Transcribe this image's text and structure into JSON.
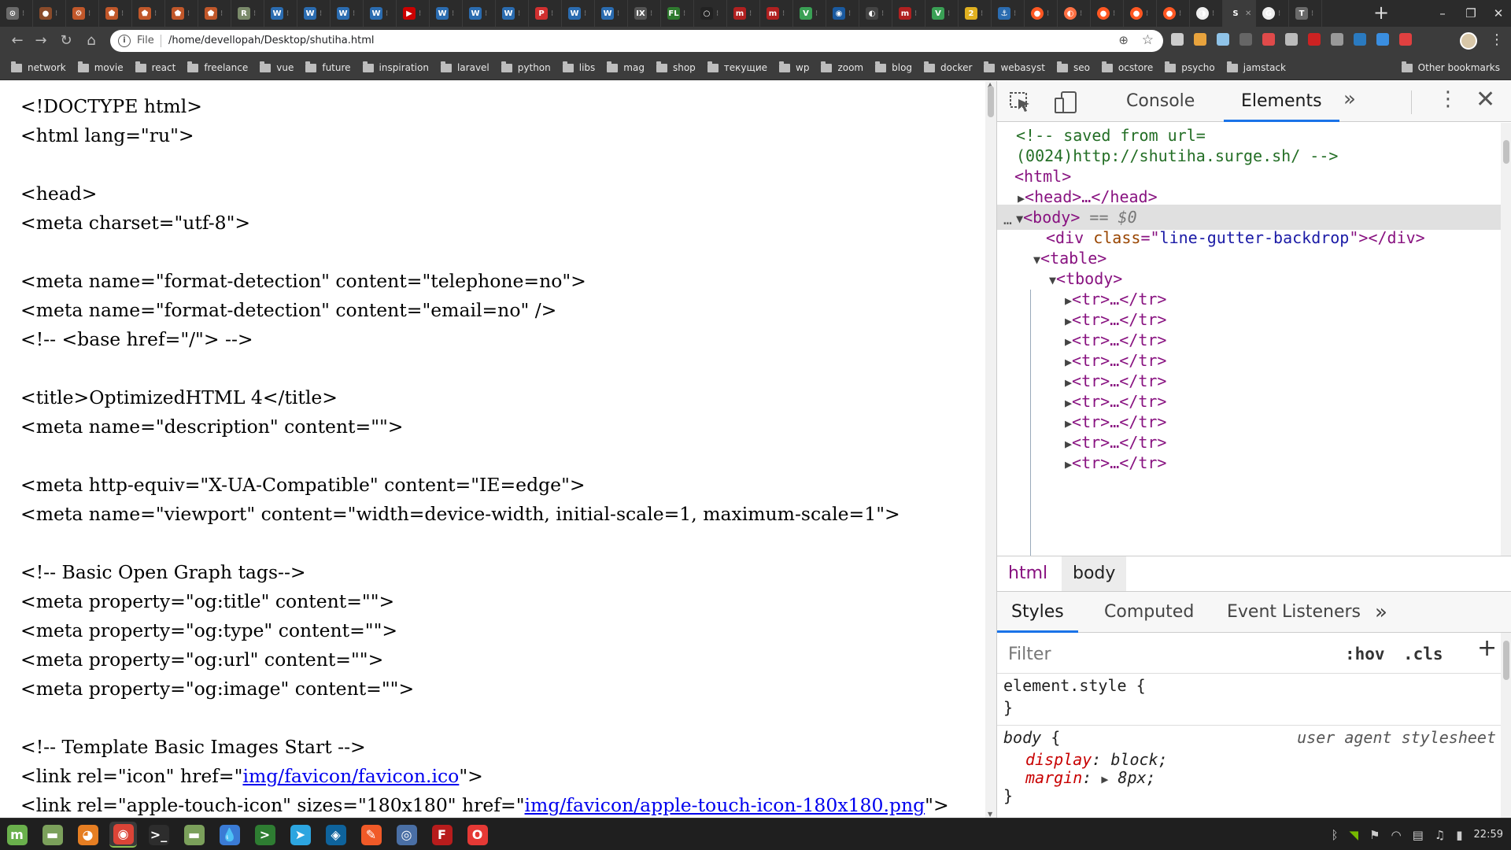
{
  "tabs": [
    {
      "fav": "#6a6a6a",
      "glyph": "⊙"
    },
    {
      "fav": "#8a4b2a",
      "glyph": "●"
    },
    {
      "fav": "#c0572a",
      "glyph": "⚙"
    },
    {
      "fav": "#c0572a",
      "glyph": "⬟"
    },
    {
      "fav": "#c0572a",
      "glyph": "⬟"
    },
    {
      "fav": "#c0572a",
      "glyph": "⬟"
    },
    {
      "fav": "#c0572a",
      "glyph": "⬟"
    },
    {
      "fav": "#7a8a6a",
      "glyph": "R"
    },
    {
      "fav": "#2b6cb0",
      "glyph": "W"
    },
    {
      "fav": "#2b6cb0",
      "glyph": "W"
    },
    {
      "fav": "#2b6cb0",
      "glyph": "W"
    },
    {
      "fav": "#2b6cb0",
      "glyph": "W"
    },
    {
      "fav": "#cc0000",
      "glyph": "▶"
    },
    {
      "fav": "#2b6cb0",
      "glyph": "W"
    },
    {
      "fav": "#2b6cb0",
      "glyph": "W"
    },
    {
      "fav": "#2b6cb0",
      "glyph": "W"
    },
    {
      "fav": "#d03030",
      "glyph": "P"
    },
    {
      "fav": "#2b6cb0",
      "glyph": "W"
    },
    {
      "fav": "#2b6cb0",
      "glyph": "W"
    },
    {
      "fav": "#555555",
      "glyph": "IX"
    },
    {
      "fav": "#2f7a2f",
      "glyph": "FL"
    },
    {
      "fav": "#222222",
      "glyph": "○"
    },
    {
      "fav": "#b02020",
      "glyph": "m"
    },
    {
      "fav": "#b02020",
      "glyph": "m"
    },
    {
      "fav": "#3aa055",
      "glyph": "V"
    },
    {
      "fav": "#1a5aa0",
      "glyph": "◉"
    },
    {
      "fav": "#444444",
      "glyph": "◐"
    },
    {
      "fav": "#b02020",
      "glyph": "m"
    },
    {
      "fav": "#3aa055",
      "glyph": "V"
    },
    {
      "fav": "#e0b020",
      "glyph": "2"
    },
    {
      "fav": "#2b6cb0",
      "glyph": "⚓"
    },
    {
      "fav": "#ff5722",
      "glyph": "●",
      "round": true
    },
    {
      "fav": "#ff7043",
      "glyph": "◐",
      "round": true
    },
    {
      "fav": "#ff5722",
      "glyph": "●",
      "round": true
    },
    {
      "fav": "#ff5722",
      "glyph": "●",
      "round": true
    },
    {
      "fav": "#ff5722",
      "glyph": "●",
      "round": true
    },
    {
      "fav": "#eeeeee",
      "glyph": "◑",
      "round": true
    },
    {
      "fav": "#3c3c3c",
      "glyph": "S",
      "active": true
    },
    {
      "fav": "#eeeeee",
      "glyph": "G",
      "round": true
    },
    {
      "fav": "#6a6a6a",
      "glyph": "T"
    }
  ],
  "toolbar": {
    "scheme": "File",
    "url": "/home/devellopah/Desktop/shutiha.html"
  },
  "extensions": [
    "#cccccc",
    "#e8a33d",
    "#8fc3e8",
    "#666666",
    "#e04a4a",
    "#bbbbbb",
    "#cc2222",
    "#999999",
    "#2a7ac0",
    "#3a8ee0",
    "#e04040"
  ],
  "bookmarks": [
    "network",
    "movie",
    "react",
    "freelance",
    "vue",
    "future",
    "inspiration",
    "laravel",
    "python",
    "libs",
    "mag",
    "shop",
    "текущие",
    "wp",
    "zoom",
    "blog",
    "docker",
    "webasyst",
    "seo",
    "ocstore",
    "psycho",
    "jamstack"
  ],
  "bookmarks_other": "Other bookmarks",
  "code_lines": [
    {
      "t": "<!DOCTYPE html>"
    },
    {
      "t": "<html lang=\"ru\">"
    },
    {
      "t": ""
    },
    {
      "t": "<head>"
    },
    {
      "t": "<meta charset=\"utf-8\">"
    },
    {
      "t": ""
    },
    {
      "t": "<meta name=\"format-detection\" content=\"telephone=no\">"
    },
    {
      "t": "<meta name=\"format-detection\" content=\"email=no\" />"
    },
    {
      "t": "<!-- <base href=\"/\"> -->"
    },
    {
      "t": ""
    },
    {
      "t": "<title>OptimizedHTML 4</title>"
    },
    {
      "t": "<meta name=\"description\" content=\"\">"
    },
    {
      "t": ""
    },
    {
      "t": "<meta http-equiv=\"X-UA-Compatible\" content=\"IE=edge\">"
    },
    {
      "t": "<meta name=\"viewport\" content=\"width=device-width, initial-scale=1, maximum-scale=1\">"
    },
    {
      "t": ""
    },
    {
      "t": "<!-- Basic Open Graph tags-->"
    },
    {
      "t": "<meta property=\"og:title\" content=\"\">"
    },
    {
      "t": "<meta property=\"og:type\" content=\"\">"
    },
    {
      "t": "<meta property=\"og:url\" content=\"\">"
    },
    {
      "t": "<meta property=\"og:image\" content=\"\">"
    },
    {
      "t": ""
    },
    {
      "t": "<!-- Template Basic Images Start -->"
    },
    {
      "t": "<link rel=\"icon\" href=\"",
      "link": "img/favicon/favicon.ico",
      "after": "\">"
    },
    {
      "t": "<link rel=\"apple-touch-icon\" sizes=\"180x180\" href=\"",
      "link": "img/favicon/apple-touch-icon-180x180.png",
      "after": "\">"
    }
  ],
  "devtools": {
    "tabs": [
      "Console",
      "Elements"
    ],
    "active_tab": "Elements",
    "tree": {
      "comment_1": "<!-- saved from url=",
      "comment_2": "(0024)http://shutiha.surge.sh/ -->",
      "html_open": "<html>",
      "head_collapsed": "<head>…</head>",
      "body_open": "<body>",
      "body_marker": "== $0",
      "div_tag": "div",
      "div_attr_name": "class",
      "div_attr_value": "line-gutter-backdrop",
      "table_open": "<table>",
      "tbody_open": "<tbody>",
      "tr_collapsed": "<tr>…</tr>",
      "tr_count": 9
    },
    "breadcrumbs": [
      "html",
      "body"
    ],
    "styles_tabs": [
      "Styles",
      "Computed",
      "Event Listeners"
    ],
    "filter_placeholder": "Filter",
    "hov_label": ":hov",
    "cls_label": ".cls",
    "rules": {
      "element_style_open": "element.style {",
      "close_brace": "}",
      "body_selector": "body",
      "open_brace": " {",
      "ua_label": "user agent stylesheet",
      "decl_1_prop": "display",
      "decl_1_val": "block;",
      "decl_2_prop": "margin",
      "decl_2_val": "8px;"
    }
  },
  "taskbar": {
    "apps": [
      {
        "color": "#6ab04c",
        "glyph": "m"
      },
      {
        "color": "#7ba05b",
        "glyph": "▬"
      },
      {
        "color": "#e67e22",
        "glyph": "◕"
      },
      {
        "color": "#db4437",
        "glyph": "◉",
        "active": true
      },
      {
        "color": "#2d2d2d",
        "glyph": ">_"
      },
      {
        "color": "#7ba05b",
        "glyph": "▬"
      },
      {
        "color": "#3a7bd5",
        "glyph": "💧"
      },
      {
        "color": "#2e7d32",
        "glyph": ">"
      },
      {
        "color": "#2ca5e0",
        "glyph": "➤"
      },
      {
        "color": "#0e639c",
        "glyph": "◈"
      },
      {
        "color": "#f05a28",
        "glyph": "✎"
      },
      {
        "color": "#4a6fa5",
        "glyph": "◎"
      },
      {
        "color": "#b71c1c",
        "glyph": "F"
      },
      {
        "color": "#e53935",
        "glyph": "O"
      }
    ],
    "clock": "22:59"
  }
}
